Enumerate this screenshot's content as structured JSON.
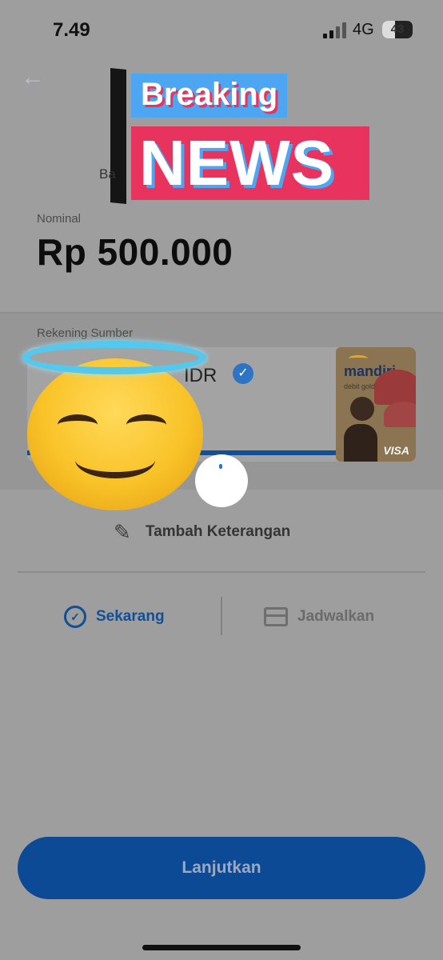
{
  "status_bar": {
    "time": "7.49",
    "network": "4G",
    "battery": "43",
    "battery_level": 0.43
  },
  "sticker": {
    "line1": "Breaking",
    "line2": "NEWS"
  },
  "recipient_fragment": "Ba",
  "nominal": {
    "label": "Nominal",
    "amount": "Rp 500.000"
  },
  "source": {
    "label": "Rekening Sumber",
    "currency": "IDR",
    "card": {
      "brand": "mandiri",
      "type": "debit gold",
      "network": "VISA"
    }
  },
  "add_note": {
    "label": "Tambah Keterangan"
  },
  "timing": {
    "now_label": "Sekarang",
    "schedule_label": "Jadwalkan"
  },
  "continue_button": {
    "label": "Lanjutkan"
  },
  "colors": {
    "primary": "#0c4a95",
    "accent_link": "#134f95",
    "overlay": "#9e9e9e"
  }
}
